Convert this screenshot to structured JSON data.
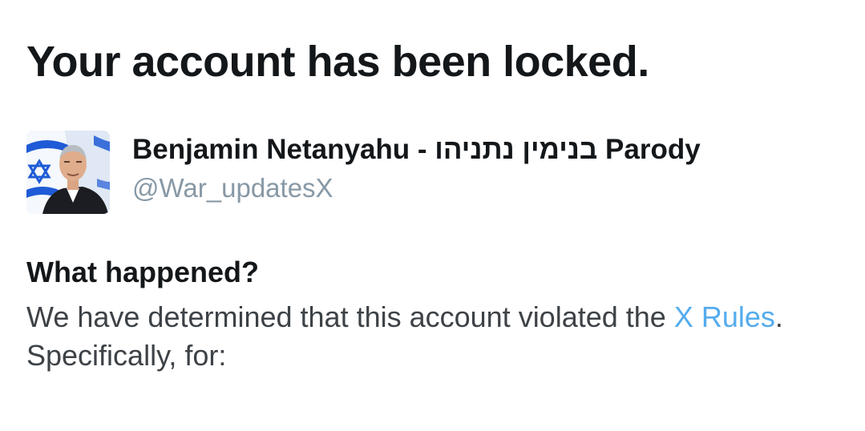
{
  "page": {
    "title": "Your account has been locked."
  },
  "account": {
    "display_name": "Benjamin Netanyahu - בנימין נתניהו Parody",
    "handle": "@War_updatesX"
  },
  "reason": {
    "heading": "What happened?",
    "text_before_link": "We have determined that this account violated the ",
    "link_label": "X Rules",
    "text_after_link": ".",
    "line2": "Specifically, for:"
  },
  "colors": {
    "link": "#55acee",
    "handle": "#8899a6",
    "text": "#14171a",
    "body_text": "#3d4247",
    "flag_blue": "#1f5bd6"
  }
}
